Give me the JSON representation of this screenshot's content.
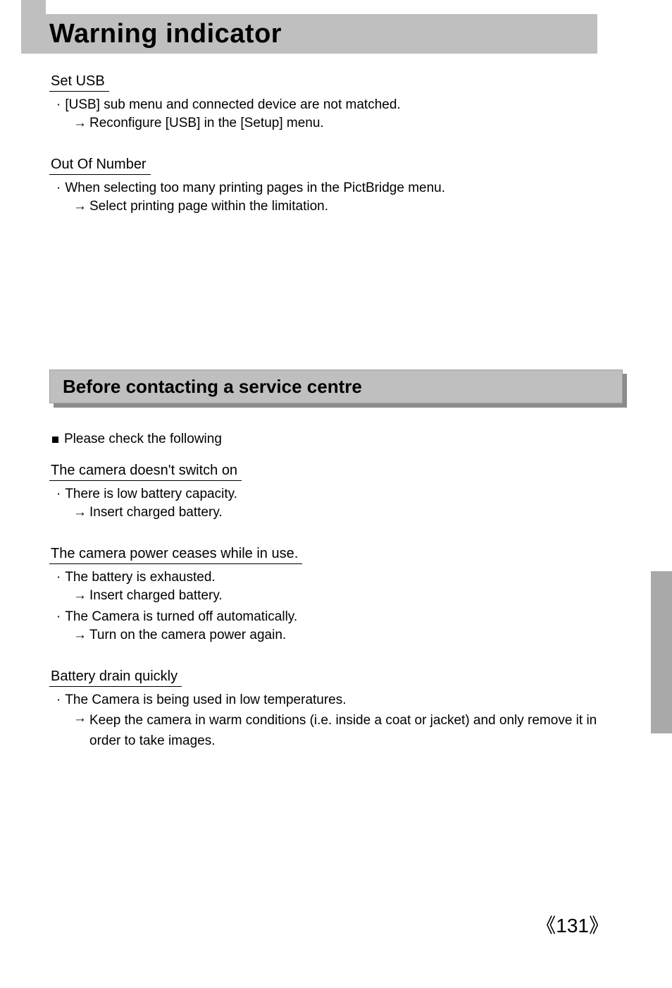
{
  "title": "Warning indicator",
  "warning_sections": [
    {
      "label": "Set USB",
      "items": [
        {
          "cause": "[USB] sub menu and connected device are not matched.",
          "remedy": "Reconfigure [USB] in the [Setup] menu."
        }
      ]
    },
    {
      "label": "Out Of Number",
      "items": [
        {
          "cause": "When selecting too many printing pages in the PictBridge menu.",
          "remedy": "Select printing page within the limitation."
        }
      ]
    }
  ],
  "subheading": "Before contacting a service centre",
  "intro": "Please check the following",
  "troubleshoot_sections": [
    {
      "label": "The camera doesn't switch on",
      "items": [
        {
          "cause": "There is low battery capacity.",
          "remedy": "Insert charged battery."
        }
      ]
    },
    {
      "label": "The camera power ceases while in use.",
      "items": [
        {
          "cause": "The battery is exhausted.",
          "remedy": "Insert charged battery."
        },
        {
          "cause": "The Camera is turned off automatically.",
          "remedy": "Turn on the camera power again."
        }
      ]
    },
    {
      "label": "Battery drain quickly",
      "items": [
        {
          "cause": "The Camera is being used in low temperatures.",
          "remedy": "Keep the camera in warm conditions (i.e. inside a coat or jacket) and only remove it in order to take images."
        }
      ]
    }
  ],
  "arrow": "→",
  "page_number_prefix": "《",
  "page_number": "131",
  "page_number_suffix": "》"
}
